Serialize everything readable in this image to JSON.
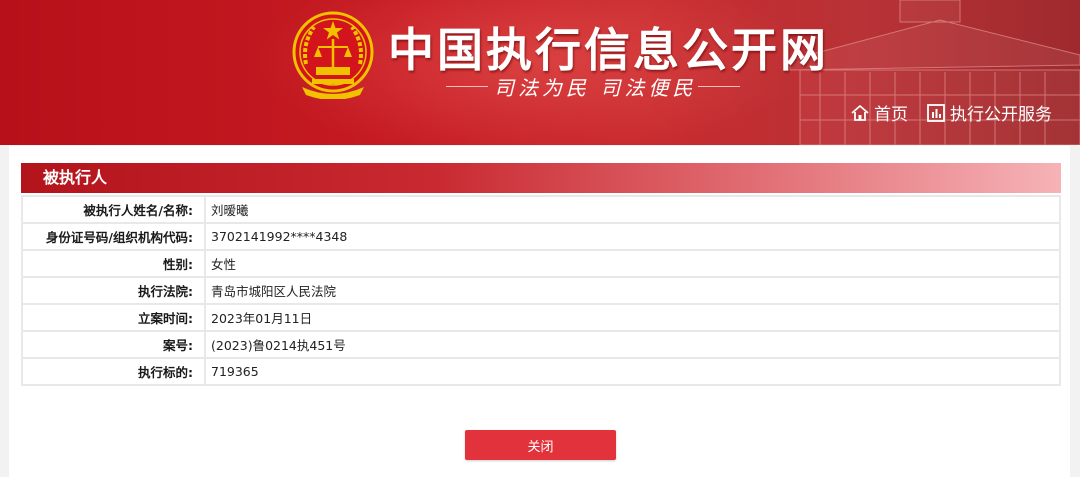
{
  "header": {
    "site_title": "中国执行信息公开网",
    "slogan": "司法为民  司法便民",
    "nav": [
      {
        "label": "首页",
        "icon": "home-icon"
      },
      {
        "label": "执行公开服务",
        "icon": "chart-icon"
      }
    ]
  },
  "section": {
    "title": "被执行人"
  },
  "fields": [
    {
      "label": "被执行人姓名/名称:",
      "value": "刘暧曦"
    },
    {
      "label": "身份证号码/组织机构代码:",
      "value": "3702141992****4348"
    },
    {
      "label": "性别:",
      "value": "女性"
    },
    {
      "label": "执行法院:",
      "value": "青岛市城阳区人民法院"
    },
    {
      "label": "立案时间:",
      "value": "2023年01月11日"
    },
    {
      "label": "案号:",
      "value": "(2023)鲁0214执451号"
    },
    {
      "label": "执行标的:",
      "value": "719365"
    }
  ],
  "actions": {
    "close_label": "关闭"
  },
  "colors": {
    "header_red": "#c51a22",
    "button_red": "#e2333c",
    "emblem_gold": "#f2c200"
  }
}
